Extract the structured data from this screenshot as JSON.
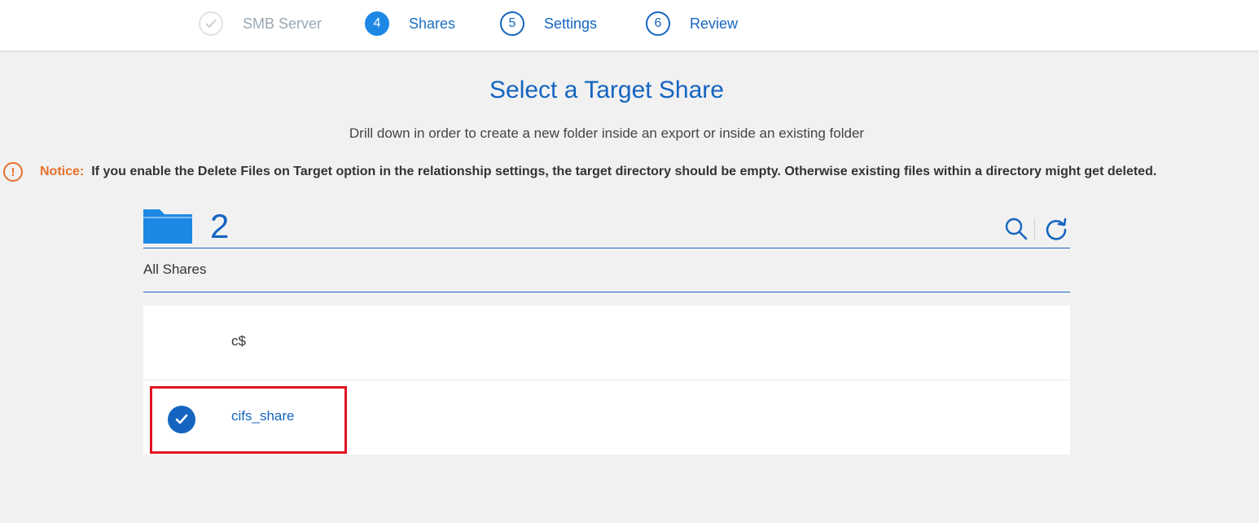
{
  "wizard": {
    "steps": [
      {
        "number": "",
        "label": "SMB Server",
        "state": "done",
        "icon": "checkmark-icon"
      },
      {
        "number": "4",
        "label": "Shares",
        "state": "active"
      },
      {
        "number": "5",
        "label": "Settings",
        "state": "todo"
      },
      {
        "number": "6",
        "label": "Review",
        "state": "todo"
      }
    ]
  },
  "page": {
    "title": "Select a Target Share",
    "subtitle": "Drill down in order to create a new folder inside an export or inside an existing folder"
  },
  "notice": {
    "icon": "exclamation-icon",
    "icon_glyph": "!",
    "label": "Notice:",
    "text": "If you enable the Delete Files on Target option in the relationship settings, the target directory should be empty. Otherwise existing files within a directory might get deleted."
  },
  "browser": {
    "folder_icon": "folder-icon",
    "count": "2",
    "search_icon": "search-icon",
    "refresh_icon": "refresh-icon",
    "breadcrumb": "All Shares",
    "items": [
      {
        "name": "c$",
        "selected": false
      },
      {
        "name": "cifs_share",
        "selected": true
      }
    ]
  },
  "colors": {
    "accent": "#1565c0",
    "active_step": "#1e88e5",
    "notice": "#e8702a",
    "highlight_box": "#e0131e",
    "background": "#f1f1f1"
  }
}
